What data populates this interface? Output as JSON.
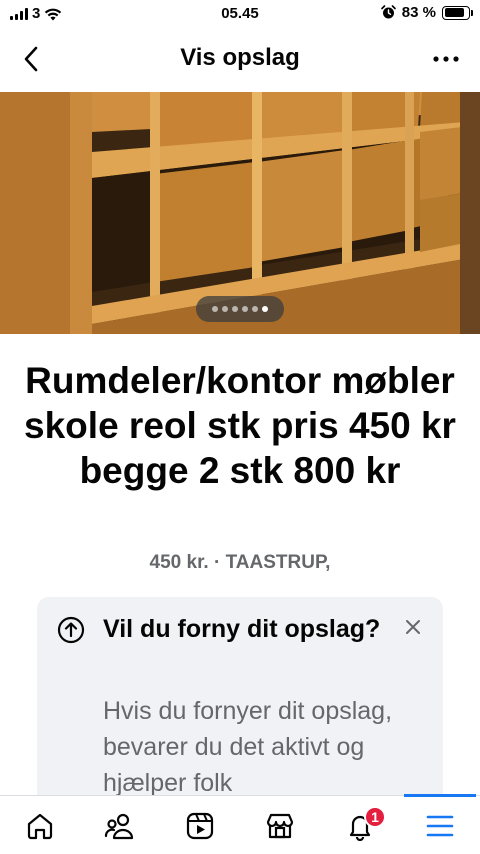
{
  "status_bar": {
    "carrier": "3",
    "time": "05.45",
    "battery_percent": "83 %",
    "battery_level": 0.83
  },
  "header": {
    "title": "Vis opslag",
    "back_icon": "chevron-left-icon",
    "more_icon": "more-horizontal-icon"
  },
  "photo": {
    "page_count": 6,
    "active_index": 5
  },
  "listing": {
    "title": "Rumdeler/kontor møbler skole reol stk pris 450 kr begge 2 stk 800 kr",
    "meta": "450 kr. · TAASTRUP,"
  },
  "renew_card": {
    "icon": "arrow-up-circle-icon",
    "title": "Vil du forny dit opslag?",
    "body": "Hvis du fornyer dit opslag, bevarer du det aktivt og hjælper folk",
    "close_icon": "close-icon"
  },
  "tabbar": {
    "tabs": [
      {
        "name": "home-icon"
      },
      {
        "name": "friends-icon"
      },
      {
        "name": "video-icon"
      },
      {
        "name": "marketplace-icon"
      },
      {
        "name": "notifications-icon",
        "badge": "1"
      },
      {
        "name": "menu-icon"
      }
    ],
    "active_tab": 5,
    "colors": {
      "active": "#1877f2",
      "badge": "#e41e3f"
    }
  }
}
